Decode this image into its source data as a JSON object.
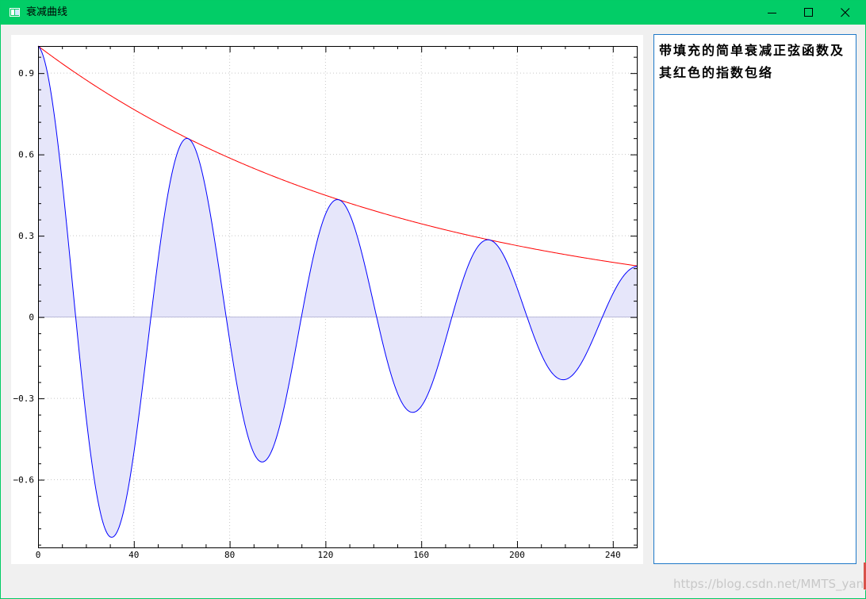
{
  "window": {
    "title": "衰减曲线"
  },
  "info_panel": {
    "text": "带填充的简单衰减正弦函数及其红色的指数包络"
  },
  "watermark": "https://blog.csdn.net/MMTS_yang",
  "chart_data": {
    "type": "line",
    "title": "",
    "xlabel": "",
    "ylabel": "",
    "xlim": [
      0,
      250
    ],
    "ylim": [
      -0.85,
      1.0
    ],
    "x_ticks": [
      0,
      40,
      80,
      120,
      160,
      200,
      240
    ],
    "x_tick_labels": [
      "0",
      "40",
      "80",
      "120",
      "160",
      "200",
      "240"
    ],
    "y_ticks": [
      -0.6,
      -0.3,
      0,
      0.3,
      0.6,
      0.9
    ],
    "y_tick_labels": [
      "−0.6",
      "−0.3",
      "0",
      "0.3",
      "0.6",
      "0.9"
    ],
    "grid": true,
    "series": [
      {
        "role": "damped-sine",
        "color": "#0000ff",
        "fill": "#e6e6fa",
        "formula": "exp(-x/150) * cos(x/10)",
        "x": [
          0,
          31.4,
          62.8,
          94.2,
          125.7,
          157.1,
          188.5,
          219.9,
          250
        ],
        "values": [
          1.0,
          -0.81,
          0.658,
          -0.534,
          0.433,
          -0.351,
          0.285,
          -0.231,
          0.189
        ]
      },
      {
        "role": "exponential-envelope",
        "color": "#ff0000",
        "formula": "exp(-x/150)",
        "x": [
          0,
          50,
          100,
          150,
          200,
          250
        ],
        "values": [
          1.0,
          0.717,
          0.513,
          0.368,
          0.264,
          0.189
        ]
      }
    ]
  }
}
